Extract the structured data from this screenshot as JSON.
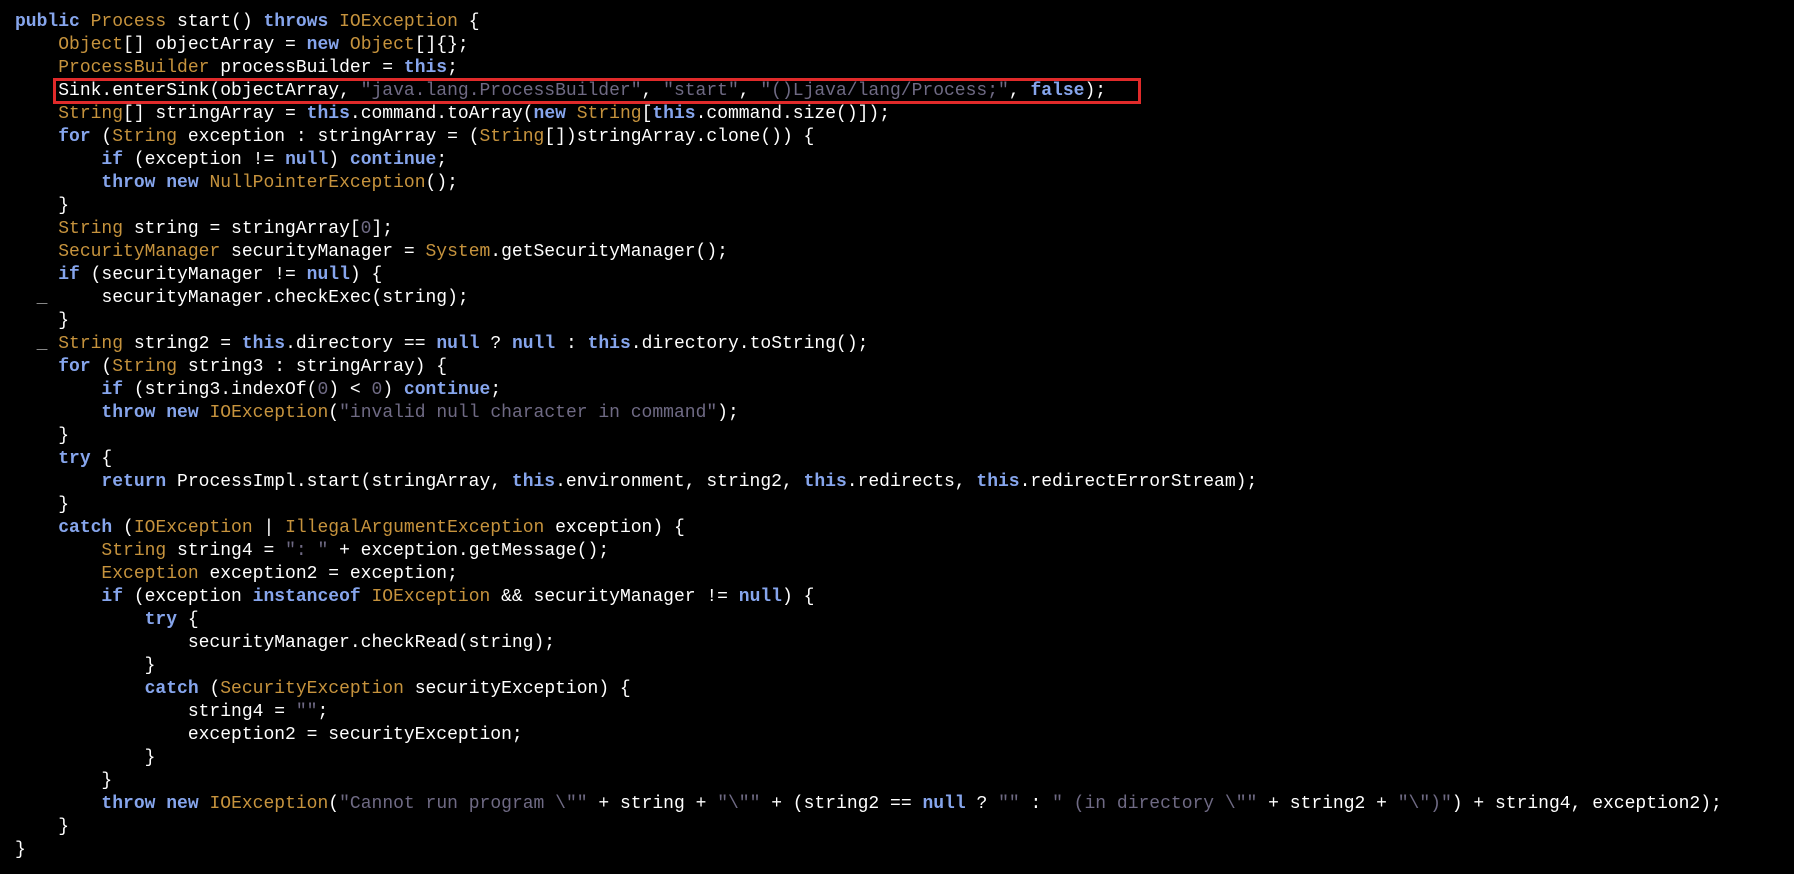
{
  "editor": {
    "highlight_color": "#e02a2a",
    "colors": {
      "background": "#000000",
      "keyword": "#86a5ec",
      "type": "#c6933d",
      "string": "#6f6a84",
      "plain": "#ffffff"
    },
    "lines": [
      [
        [
          "kw",
          "public"
        ],
        [
          "pl",
          " "
        ],
        [
          "ty",
          "Process"
        ],
        [
          "pl",
          " start() "
        ],
        [
          "kw",
          "throws"
        ],
        [
          "pl",
          " "
        ],
        [
          "ty",
          "IOException"
        ],
        [
          "pl",
          " {"
        ]
      ],
      [
        [
          "ind",
          "    "
        ],
        [
          "ty",
          "Object"
        ],
        [
          "pl",
          "[] objectArray = "
        ],
        [
          "kw",
          "new"
        ],
        [
          "pl",
          " "
        ],
        [
          "ty",
          "Object"
        ],
        [
          "pl",
          "[]{};"
        ]
      ],
      [
        [
          "ind",
          "    "
        ],
        [
          "ty",
          "ProcessBuilder"
        ],
        [
          "pl",
          " processBuilder = "
        ],
        [
          "kw",
          "this"
        ],
        [
          "pl",
          ";"
        ]
      ],
      [
        [
          "ind",
          "    "
        ],
        [
          "pl",
          "Sink.enterSink(objectArray, "
        ],
        [
          "st",
          "\"java.lang.ProcessBuilder\""
        ],
        [
          "pl",
          ", "
        ],
        [
          "st",
          "\"start\""
        ],
        [
          "pl",
          ", "
        ],
        [
          "st",
          "\"()Ljava/lang/Process;\""
        ],
        [
          "pl",
          ", "
        ],
        [
          "kw",
          "false"
        ],
        [
          "pl",
          ");"
        ]
      ],
      [
        [
          "ind",
          "    "
        ],
        [
          "ty",
          "String"
        ],
        [
          "pl",
          "[] stringArray = "
        ],
        [
          "kw",
          "this"
        ],
        [
          "pl",
          ".command.toArray("
        ],
        [
          "kw",
          "new"
        ],
        [
          "pl",
          " "
        ],
        [
          "ty",
          "String"
        ],
        [
          "pl",
          "["
        ],
        [
          "kw",
          "this"
        ],
        [
          "pl",
          ".command.size()]);"
        ]
      ],
      [
        [
          "ind",
          "    "
        ],
        [
          "kw",
          "for"
        ],
        [
          "pl",
          " ("
        ],
        [
          "ty",
          "String"
        ],
        [
          "pl",
          " exception : stringArray = ("
        ],
        [
          "ty",
          "String"
        ],
        [
          "pl",
          "[])stringArray.clone()) {"
        ]
      ],
      [
        [
          "ind",
          "        "
        ],
        [
          "kw",
          "if"
        ],
        [
          "pl",
          " (exception != "
        ],
        [
          "kw",
          "null"
        ],
        [
          "pl",
          ") "
        ],
        [
          "kw",
          "continue"
        ],
        [
          "pl",
          ";"
        ]
      ],
      [
        [
          "ind",
          "        "
        ],
        [
          "kw",
          "throw"
        ],
        [
          "pl",
          " "
        ],
        [
          "kw",
          "new"
        ],
        [
          "pl",
          " "
        ],
        [
          "ty",
          "NullPointerException"
        ],
        [
          "pl",
          "();"
        ]
      ],
      [
        [
          "ind",
          "    "
        ],
        [
          "pl",
          "}"
        ]
      ],
      [
        [
          "ind",
          "    "
        ],
        [
          "ty",
          "String"
        ],
        [
          "pl",
          " string = stringArray["
        ],
        [
          "nu",
          "0"
        ],
        [
          "pl",
          "];"
        ]
      ],
      [
        [
          "ind",
          "    "
        ],
        [
          "ty",
          "SecurityManager"
        ],
        [
          "pl",
          " securityManager = "
        ],
        [
          "ty",
          "System"
        ],
        [
          "pl",
          ".getSecurityManager();"
        ]
      ],
      [
        [
          "ind",
          "    "
        ],
        [
          "kw",
          "if"
        ],
        [
          "pl",
          " (securityManager != "
        ],
        [
          "kw",
          "null"
        ],
        [
          "pl",
          ") {"
        ]
      ],
      [
        [
          "mk",
          "  _ "
        ],
        [
          "ind",
          "    "
        ],
        [
          "pl",
          "securityManager.checkExec(string);"
        ]
      ],
      [
        [
          "ind",
          "    "
        ],
        [
          "pl",
          "}"
        ]
      ],
      [
        [
          "mk",
          "  _ "
        ],
        [
          "ty",
          "String"
        ],
        [
          "pl",
          " string2 = "
        ],
        [
          "kw",
          "this"
        ],
        [
          "pl",
          ".directory == "
        ],
        [
          "kw",
          "null"
        ],
        [
          "pl",
          " ? "
        ],
        [
          "kw",
          "null"
        ],
        [
          "pl",
          " : "
        ],
        [
          "kw",
          "this"
        ],
        [
          "pl",
          ".directory.toString();"
        ]
      ],
      [
        [
          "ind",
          "    "
        ],
        [
          "kw",
          "for"
        ],
        [
          "pl",
          " ("
        ],
        [
          "ty",
          "String"
        ],
        [
          "pl",
          " string3 : stringArray) {"
        ]
      ],
      [
        [
          "ind",
          "        "
        ],
        [
          "kw",
          "if"
        ],
        [
          "pl",
          " (string3.indexOf("
        ],
        [
          "nu",
          "0"
        ],
        [
          "pl",
          ") < "
        ],
        [
          "nu",
          "0"
        ],
        [
          "pl",
          ") "
        ],
        [
          "kw",
          "continue"
        ],
        [
          "pl",
          ";"
        ]
      ],
      [
        [
          "ind",
          "        "
        ],
        [
          "kw",
          "throw"
        ],
        [
          "pl",
          " "
        ],
        [
          "kw",
          "new"
        ],
        [
          "pl",
          " "
        ],
        [
          "ty",
          "IOException"
        ],
        [
          "pl",
          "("
        ],
        [
          "st",
          "\"invalid null character in command\""
        ],
        [
          "pl",
          ");"
        ]
      ],
      [
        [
          "ind",
          "    "
        ],
        [
          "pl",
          "}"
        ]
      ],
      [
        [
          "ind",
          "    "
        ],
        [
          "kw",
          "try"
        ],
        [
          "pl",
          " {"
        ]
      ],
      [
        [
          "ind",
          "        "
        ],
        [
          "kw",
          "return"
        ],
        [
          "pl",
          " ProcessImpl.start(stringArray, "
        ],
        [
          "kw",
          "this"
        ],
        [
          "pl",
          ".environment, string2, "
        ],
        [
          "kw",
          "this"
        ],
        [
          "pl",
          ".redirects, "
        ],
        [
          "kw",
          "this"
        ],
        [
          "pl",
          ".redirectErrorStream);"
        ]
      ],
      [
        [
          "ind",
          "    "
        ],
        [
          "pl",
          "}"
        ]
      ],
      [
        [
          "ind",
          "    "
        ],
        [
          "kw",
          "catch"
        ],
        [
          "pl",
          " ("
        ],
        [
          "ty",
          "IOException"
        ],
        [
          "pl",
          " | "
        ],
        [
          "ty",
          "IllegalArgumentException"
        ],
        [
          "pl",
          " exception) {"
        ]
      ],
      [
        [
          "ind",
          "        "
        ],
        [
          "ty",
          "String"
        ],
        [
          "pl",
          " string4 = "
        ],
        [
          "st",
          "\": \""
        ],
        [
          "pl",
          " + exception.getMessage();"
        ]
      ],
      [
        [
          "ind",
          "        "
        ],
        [
          "ty",
          "Exception"
        ],
        [
          "pl",
          " exception2 = exception;"
        ]
      ],
      [
        [
          "ind",
          "        "
        ],
        [
          "kw",
          "if"
        ],
        [
          "pl",
          " (exception "
        ],
        [
          "kw",
          "instanceof"
        ],
        [
          "pl",
          " "
        ],
        [
          "ty",
          "IOException"
        ],
        [
          "pl",
          " && securityManager != "
        ],
        [
          "kw",
          "null"
        ],
        [
          "pl",
          ") {"
        ]
      ],
      [
        [
          "ind",
          "            "
        ],
        [
          "kw",
          "try"
        ],
        [
          "pl",
          " {"
        ]
      ],
      [
        [
          "ind",
          "                "
        ],
        [
          "pl",
          "securityManager.checkRead(string);"
        ]
      ],
      [
        [
          "ind",
          "            "
        ],
        [
          "pl",
          "}"
        ]
      ],
      [
        [
          "ind",
          "            "
        ],
        [
          "kw",
          "catch"
        ],
        [
          "pl",
          " ("
        ],
        [
          "ty",
          "SecurityException"
        ],
        [
          "pl",
          " securityException) {"
        ]
      ],
      [
        [
          "ind",
          "                "
        ],
        [
          "pl",
          "string4 = "
        ],
        [
          "st",
          "\"\""
        ],
        [
          "pl",
          ";"
        ]
      ],
      [
        [
          "ind",
          "                "
        ],
        [
          "pl",
          "exception2 = securityException;"
        ]
      ],
      [
        [
          "ind",
          "            "
        ],
        [
          "pl",
          "}"
        ]
      ],
      [
        [
          "ind",
          "        "
        ],
        [
          "pl",
          "}"
        ]
      ],
      [
        [
          "ind",
          "        "
        ],
        [
          "kw",
          "throw"
        ],
        [
          "pl",
          " "
        ],
        [
          "kw",
          "new"
        ],
        [
          "pl",
          " "
        ],
        [
          "ty",
          "IOException"
        ],
        [
          "pl",
          "("
        ],
        [
          "st",
          "\"Cannot run program \\\"\""
        ],
        [
          "pl",
          " + string + "
        ],
        [
          "st",
          "\"\\\"\""
        ],
        [
          "pl",
          " + (string2 == "
        ],
        [
          "kw",
          "null"
        ],
        [
          "pl",
          " ? "
        ],
        [
          "st",
          "\"\""
        ],
        [
          "pl",
          " : "
        ],
        [
          "st",
          "\" (in directory \\\"\""
        ],
        [
          "pl",
          " + string2 + "
        ],
        [
          "st",
          "\"\\\")\""
        ],
        [
          "pl",
          ") + string4, exception2);"
        ]
      ],
      [
        [
          "ind",
          "    "
        ],
        [
          "pl",
          "}"
        ]
      ],
      [
        [
          "pl",
          "}"
        ]
      ]
    ]
  }
}
